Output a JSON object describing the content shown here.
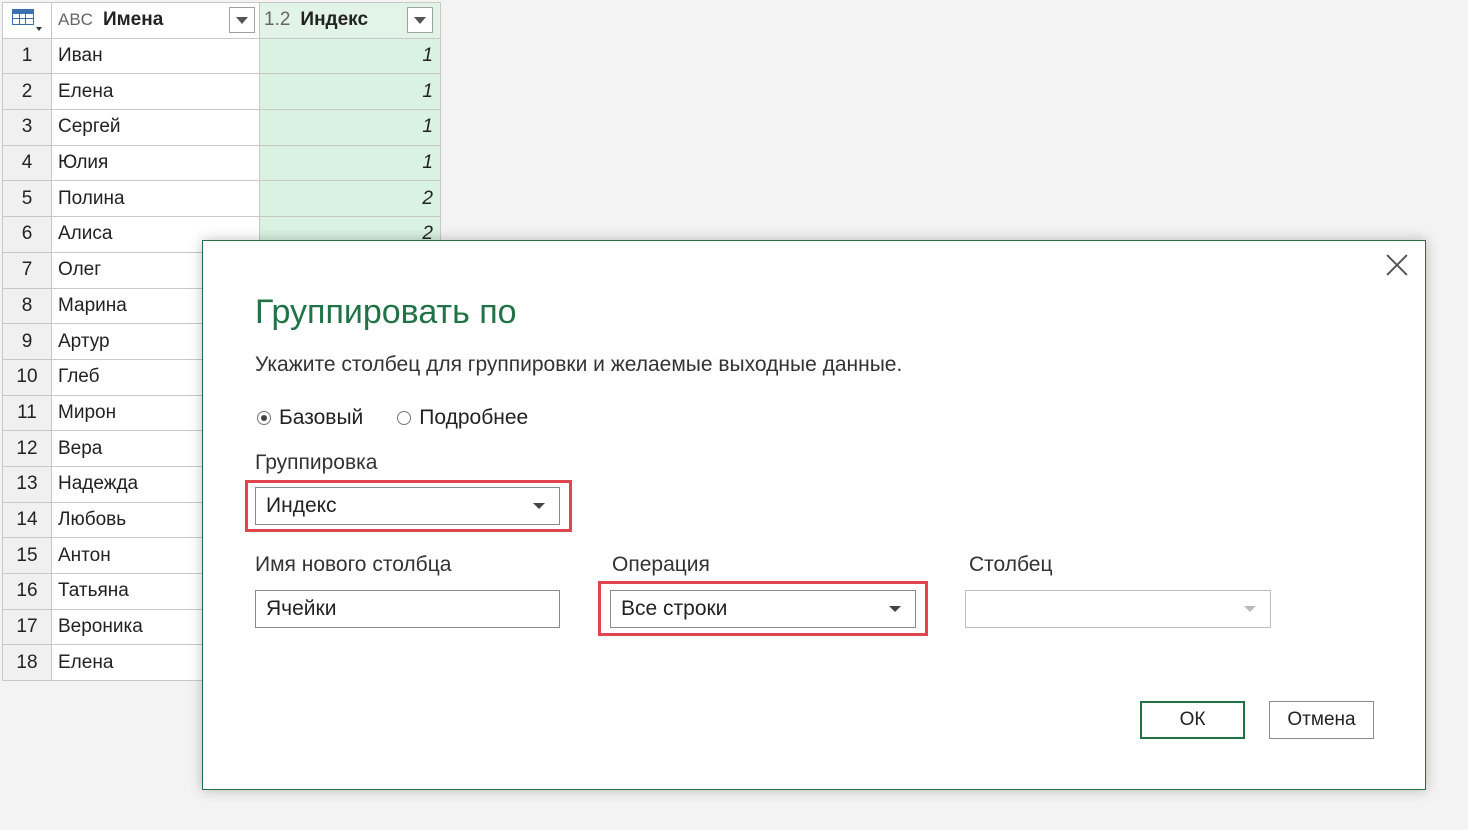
{
  "grid": {
    "columns": [
      {
        "type_icon": "ABC",
        "name": "Имена"
      },
      {
        "type_icon": "1.2",
        "name": "Индекс"
      }
    ],
    "rows": [
      {
        "n": "1",
        "name": "Иван",
        "idx": "1"
      },
      {
        "n": "2",
        "name": "Елена",
        "idx": "1"
      },
      {
        "n": "3",
        "name": "Сергей",
        "idx": "1"
      },
      {
        "n": "4",
        "name": "Юлия",
        "idx": "1"
      },
      {
        "n": "5",
        "name": "Полина",
        "idx": "2"
      },
      {
        "n": "6",
        "name": "Алиса",
        "idx": "2"
      },
      {
        "n": "7",
        "name": "Олег",
        "idx": ""
      },
      {
        "n": "8",
        "name": "Марина",
        "idx": ""
      },
      {
        "n": "9",
        "name": "Артур",
        "idx": ""
      },
      {
        "n": "10",
        "name": "Глеб",
        "idx": ""
      },
      {
        "n": "11",
        "name": "Мирон",
        "idx": ""
      },
      {
        "n": "12",
        "name": "Вера",
        "idx": ""
      },
      {
        "n": "13",
        "name": "Надежда",
        "idx": ""
      },
      {
        "n": "14",
        "name": "Любовь",
        "idx": ""
      },
      {
        "n": "15",
        "name": "Антон",
        "idx": ""
      },
      {
        "n": "16",
        "name": "Татьяна",
        "idx": ""
      },
      {
        "n": "17",
        "name": "Вероника",
        "idx": ""
      },
      {
        "n": "18",
        "name": "Елена",
        "idx": ""
      }
    ]
  },
  "dialog": {
    "title": "Группировать по",
    "subtitle": "Укажите столбец для группировки и желаемые выходные данные.",
    "radio_basic": "Базовый",
    "radio_advanced": "Подробнее",
    "group_label": "Группировка",
    "group_value": "Индекс",
    "new_col_label": "Имя нового столбца",
    "new_col_value": "Ячейки",
    "operation_label": "Операция",
    "operation_value": "Все строки",
    "column_label": "Столбец",
    "column_value": "",
    "ok": "ОК",
    "cancel": "Отмена"
  },
  "colors": {
    "accent": "#217346",
    "highlight": "#e1454f",
    "index_fill": "#d9f2e1"
  }
}
